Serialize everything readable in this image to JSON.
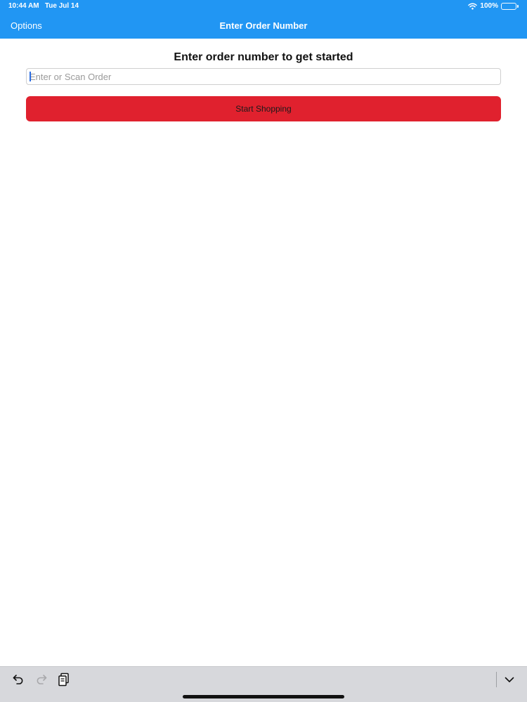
{
  "status_bar": {
    "time": "10:44 AM",
    "date": "Tue Jul 14",
    "battery": "100%",
    "wifi_icon": "wifi-icon",
    "battery_icon": "battery-icon"
  },
  "nav": {
    "options_label": "Options",
    "title": "Enter Order Number"
  },
  "main": {
    "prompt": "Enter order number to get started",
    "order_input": {
      "value": "",
      "placeholder": "Enter or Scan Order"
    },
    "start_button_label": "Start Shopping"
  },
  "keyboard_toolbar": {
    "icons": [
      "undo-icon",
      "redo-icon",
      "paste-icon",
      "chevron-down-icon"
    ]
  },
  "colors": {
    "nav_bar": "#2196f3",
    "start_button": "#e0212e",
    "keyboard_bar": "#d7d8dc"
  }
}
